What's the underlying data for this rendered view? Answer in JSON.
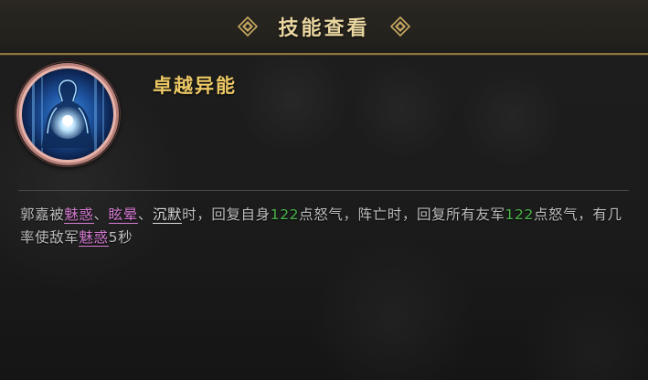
{
  "header": {
    "title": "技能查看",
    "ornament_icon": "diamond-ornament-icon"
  },
  "skill": {
    "icon": "glowing-figure-icon",
    "name": "卓越异能"
  },
  "description": {
    "p1": "郭嘉被",
    "charm_1": "魅惑",
    "sep_1": "、",
    "dizzy": "眩晕",
    "sep_2": "、",
    "silence": "沉默",
    "p2": "时，回复自身",
    "rage_self": "122",
    "p3": "点怒气，阵亡时，回复所有友军",
    "rage_allies": "122",
    "p4": "点怒气，有几率使敌军",
    "charm_2": "魅惑",
    "charm_duration": "5",
    "p5": "秒"
  },
  "colors": {
    "title": "#e9d6a0",
    "skill_name": "#ecc866",
    "status_keyword": "#d37bd0",
    "number": "#4ab54a",
    "body_text": "#bdbdbd",
    "title_border": "#8c7540"
  }
}
